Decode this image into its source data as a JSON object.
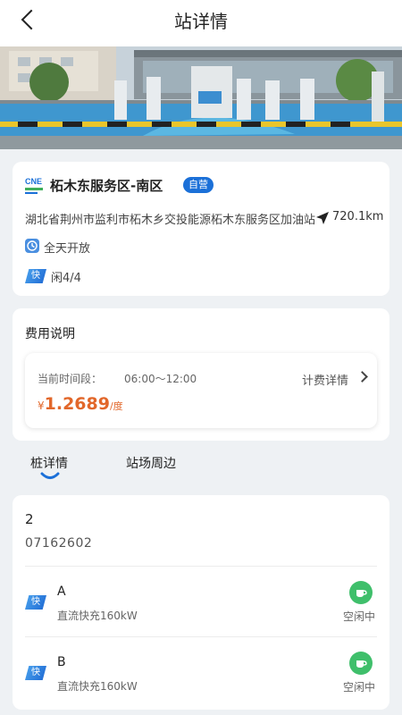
{
  "header": {
    "title": "站详情"
  },
  "station": {
    "logo_text": "CNE",
    "name": "柘木东服务区-南区",
    "badge": "自营",
    "address": "湖北省荆州市监利市柘木乡交投能源柘木东服务区加油站",
    "distance": "720.1km",
    "open_hours": "全天开放",
    "fast_tag": "快",
    "idle_count": "闲4/4"
  },
  "fee": {
    "title": "费用说明",
    "period_label": "当前时间段：",
    "period_time": "06:00～12:00",
    "detail_link": "计费详情",
    "currency": "¥",
    "price": "1.2689",
    "unit": "/度"
  },
  "tabs": [
    {
      "label": "桩详情",
      "active": true
    },
    {
      "label": "站场周边",
      "active": false
    }
  ],
  "pile": {
    "number": "2",
    "code": "07162602",
    "connectors": [
      {
        "tag": "快",
        "name": "A",
        "type": "直流快充160kW",
        "status": "空闲中"
      },
      {
        "tag": "快",
        "name": "B",
        "type": "直流快充160kW",
        "status": "空闲中"
      }
    ]
  },
  "colors": {
    "brand_blue": "#1b70d8",
    "price_orange": "#e2672a",
    "idle_green": "#3fbf6b"
  },
  "icons": {
    "back": "chevron-left-icon",
    "navigate": "navigation-arrow-icon",
    "clock": "clock-icon",
    "idle": "cup-icon",
    "detail": "chevron-right-icon"
  }
}
